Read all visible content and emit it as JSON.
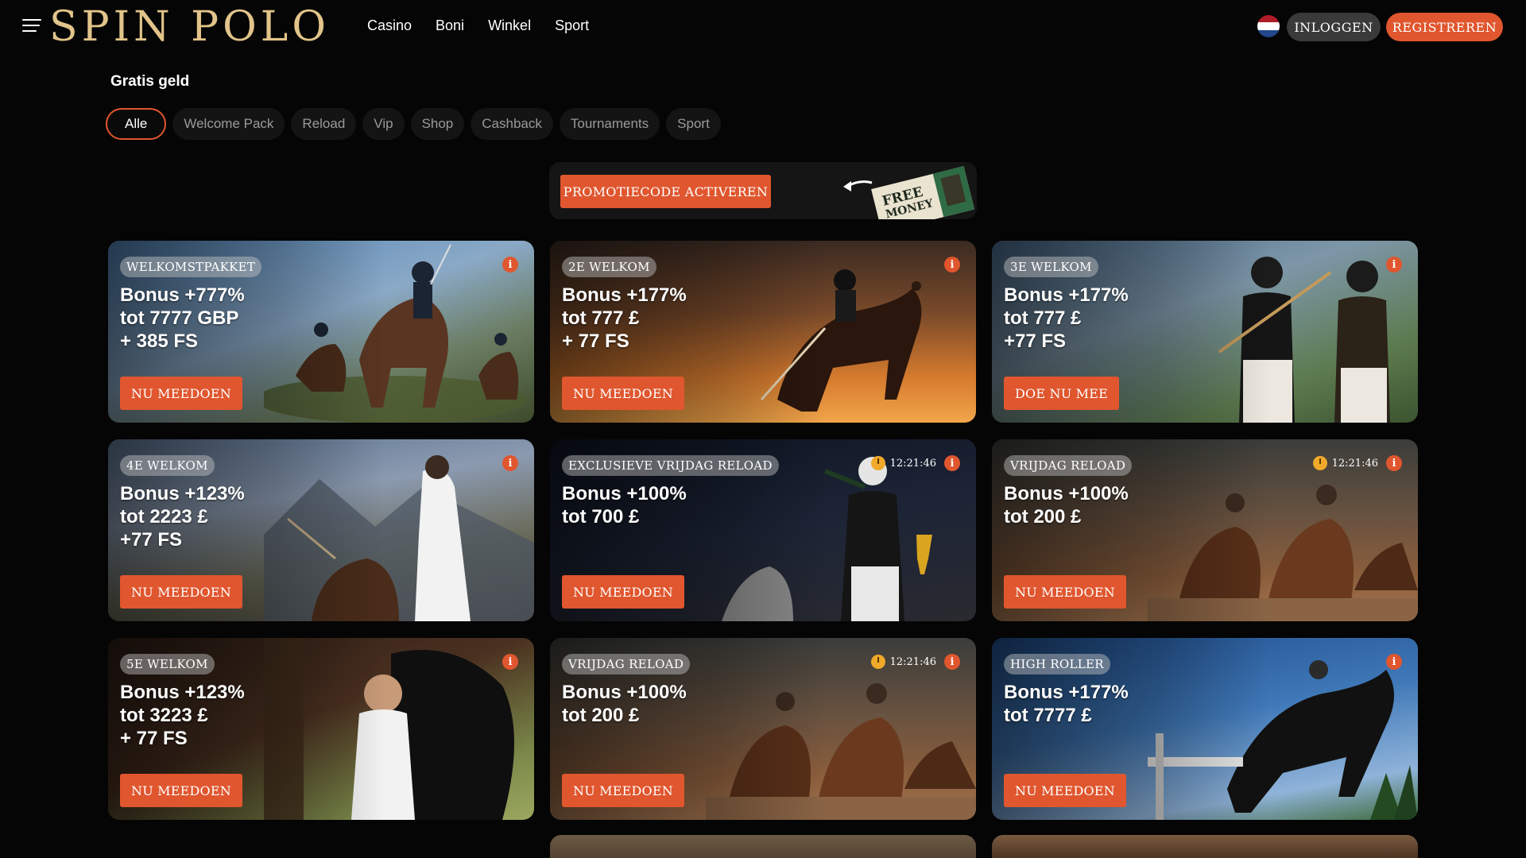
{
  "header": {
    "logo": "SPIN POLO",
    "nav": [
      "Casino",
      "Boni",
      "Winkel",
      "Sport"
    ],
    "login_label": "INLOGGEN",
    "register_label": "REGISTREREN",
    "flag_icon": "netherlands-flag-icon"
  },
  "page": {
    "title": "Gratis geld",
    "filters": [
      "Alle",
      "Welcome Pack",
      "Reload",
      "Vip",
      "Shop",
      "Cashback",
      "Tournaments",
      "Sport"
    ],
    "active_filter": "Alle"
  },
  "promo": {
    "button_label": "PROMOTIECODE ACTIVEREN",
    "art_text_1": "FREE",
    "art_text_2": "MONEY"
  },
  "colors": {
    "accent": "#e0562e",
    "logo_gold": "#e2c48a",
    "background": "#050505"
  },
  "cards": [
    {
      "tag": "WELKOMSTPAKKET",
      "lines": [
        "Bonus +777%",
        "tot 7777 GBP",
        "+ 385 FS"
      ],
      "button": "NU MEEDOEN",
      "timer": ""
    },
    {
      "tag": "2E WELKOM",
      "lines": [
        "Bonus +177%",
        "tot 777 £",
        "+ 77 FS"
      ],
      "button": "NU MEEDOEN",
      "timer": ""
    },
    {
      "tag": "3E WELKOM",
      "lines": [
        "Bonus +177%",
        "tot 777 £",
        "+77 FS"
      ],
      "button": "DOE NU MEE",
      "timer": ""
    },
    {
      "tag": "4E WELKOM",
      "lines": [
        "Bonus +123%",
        "tot 2223 £",
        "+77 FS"
      ],
      "button": "NU MEEDOEN",
      "timer": ""
    },
    {
      "tag": "EXCLUSIEVE VRIJDAG RELOAD",
      "lines": [
        "Bonus +100%",
        "tot 700 £"
      ],
      "button": "NU MEEDOEN",
      "timer": "12:21:46"
    },
    {
      "tag": "VRIJDAG RELOAD",
      "lines": [
        "Bonus +100%",
        "tot 200 £"
      ],
      "button": "NU MEEDOEN",
      "timer": "12:21:46"
    },
    {
      "tag": "5E WELKOM",
      "lines": [
        "Bonus +123%",
        "tot 3223 £",
        "+ 77 FS"
      ],
      "button": "NU MEEDOEN",
      "timer": ""
    },
    {
      "tag": "VRIJDAG RELOAD",
      "lines": [
        "Bonus +100%",
        "tot 200 £"
      ],
      "button": "NU MEEDOEN",
      "timer": "12:21:46"
    },
    {
      "tag": "HIGH ROLLER",
      "lines": [
        "Bonus +177%",
        "tot 7777 £"
      ],
      "button": "NU MEEDOEN",
      "timer": ""
    }
  ],
  "info_icon_label": "i"
}
